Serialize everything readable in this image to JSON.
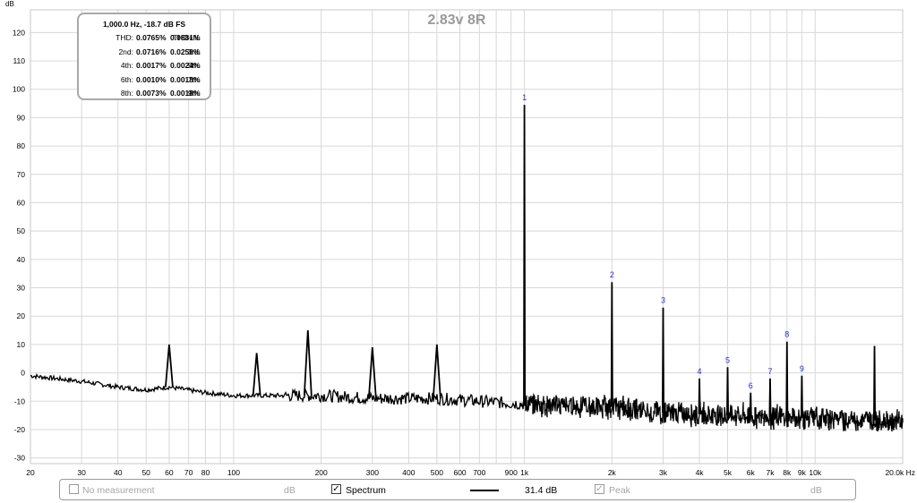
{
  "chart_data": {
    "type": "line",
    "title": "2.83v 8R",
    "ylabel": "dB",
    "xlabel": "Hz",
    "xscale": "log",
    "xlim": [
      20,
      20000
    ],
    "ylim": [
      -32,
      128
    ],
    "yticks": [
      120,
      110,
      100,
      90,
      80,
      70,
      60,
      50,
      40,
      30,
      20,
      10,
      0,
      -10,
      -20,
      -30
    ],
    "xticks": [
      {
        "v": 20,
        "label": "20"
      },
      {
        "v": 30,
        "label": "30"
      },
      {
        "v": 40,
        "label": "40"
      },
      {
        "v": 50,
        "label": "50"
      },
      {
        "v": 60,
        "label": "60"
      },
      {
        "v": 70,
        "label": "70"
      },
      {
        "v": 80,
        "label": "80"
      },
      {
        "v": 100,
        "label": "100"
      },
      {
        "v": 200,
        "label": "200"
      },
      {
        "v": 300,
        "label": "300"
      },
      {
        "v": 400,
        "label": "400"
      },
      {
        "v": 500,
        "label": "500"
      },
      {
        "v": 600,
        "label": "600"
      },
      {
        "v": 700,
        "label": "700"
      },
      {
        "v": 900,
        "label": "900"
      },
      {
        "v": 1000,
        "label": "1k"
      },
      {
        "v": 2000,
        "label": "2k"
      },
      {
        "v": 3000,
        "label": "3k"
      },
      {
        "v": 4000,
        "label": "4k"
      },
      {
        "v": 5000,
        "label": "5k"
      },
      {
        "v": 6000,
        "label": "6k"
      },
      {
        "v": 7000,
        "label": "7k"
      },
      {
        "v": 8000,
        "label": "8k"
      },
      {
        "v": 9000,
        "label": "9k"
      },
      {
        "v": 10000,
        "label": "10k"
      },
      {
        "v": 20000,
        "label": "20.0k Hz"
      }
    ],
    "grid": true,
    "series": [
      {
        "name": "Spectrum",
        "color": "#000000",
        "noise_floor": [
          [
            20,
            -1
          ],
          [
            30,
            -3
          ],
          [
            40,
            -5
          ],
          [
            50,
            -6
          ],
          [
            60,
            -5
          ],
          [
            80,
            -7
          ],
          [
            100,
            -8
          ],
          [
            150,
            -8
          ],
          [
            200,
            -8
          ],
          [
            300,
            -9
          ],
          [
            500,
            -9
          ],
          [
            700,
            -10
          ],
          [
            1000,
            -11
          ],
          [
            2000,
            -12
          ],
          [
            3000,
            -14
          ],
          [
            5000,
            -15
          ],
          [
            10000,
            -16
          ],
          [
            20000,
            -17
          ]
        ],
        "peaks": [
          {
            "f": 60,
            "db": 10
          },
          {
            "f": 120,
            "db": 7
          },
          {
            "f": 180,
            "db": 15
          },
          {
            "f": 300,
            "db": 9
          },
          {
            "f": 500,
            "db": 10
          },
          {
            "f": 1000,
            "db": 94.5
          },
          {
            "f": 2000,
            "db": 32
          },
          {
            "f": 3000,
            "db": 23
          },
          {
            "f": 4000,
            "db": -2
          },
          {
            "f": 5000,
            "db": 2
          },
          {
            "f": 6000,
            "db": -7
          },
          {
            "f": 7000,
            "db": -2
          },
          {
            "f": 8000,
            "db": 11
          },
          {
            "f": 9000,
            "db": -1
          },
          {
            "f": 16000,
            "db": 9.5
          }
        ]
      }
    ],
    "harmonic_markers": [
      {
        "n": "1",
        "f": 1000,
        "db": 94.5
      },
      {
        "n": "2",
        "f": 2000,
        "db": 32
      },
      {
        "n": "3",
        "f": 3000,
        "db": 23
      },
      {
        "n": "4",
        "f": 4000,
        "db": -2
      },
      {
        "n": "5",
        "f": 5000,
        "db": 2
      },
      {
        "n": "6",
        "f": 6000,
        "db": -7
      },
      {
        "n": "7",
        "f": 7000,
        "db": -2
      },
      {
        "n": "8",
        "f": 8000,
        "db": 11
      },
      {
        "n": "9",
        "f": 9000,
        "db": -1
      }
    ],
    "colors": {
      "grid": "#d8d8d8",
      "plot_border": "#c8c8c8",
      "marker_text": "#1c2fd8",
      "title": "#9a9a9a"
    }
  },
  "info_box": {
    "header": "1,000.0 Hz, -18.7 dB FS",
    "rows": [
      {
        "l": "THD:",
        "lv": "0.0765%",
        "r": "THD+N:",
        "rv": "0.0881%"
      },
      {
        "l": "2nd:",
        "lv": "0.0716%",
        "r": "3rd:",
        "rv": "0.0258%"
      },
      {
        "l": "4th:",
        "lv": "0.0017%",
        "r": "5th:",
        "rv": "0.0024%"
      },
      {
        "l": "6th:",
        "lv": "0.0010%",
        "r": "7th:",
        "rv": "0.0018%"
      },
      {
        "l": "8th:",
        "lv": "0.0073%",
        "r": "9th:",
        "rv": "0.0018%"
      }
    ]
  },
  "legend": {
    "no_measurement": {
      "label": "No measurement",
      "unit": "dB",
      "checked": false
    },
    "spectrum": {
      "label": "Spectrum",
      "value": "31.4 dB",
      "checked": true
    },
    "peak": {
      "label": "Peak",
      "unit": "dB",
      "checked": true
    }
  }
}
